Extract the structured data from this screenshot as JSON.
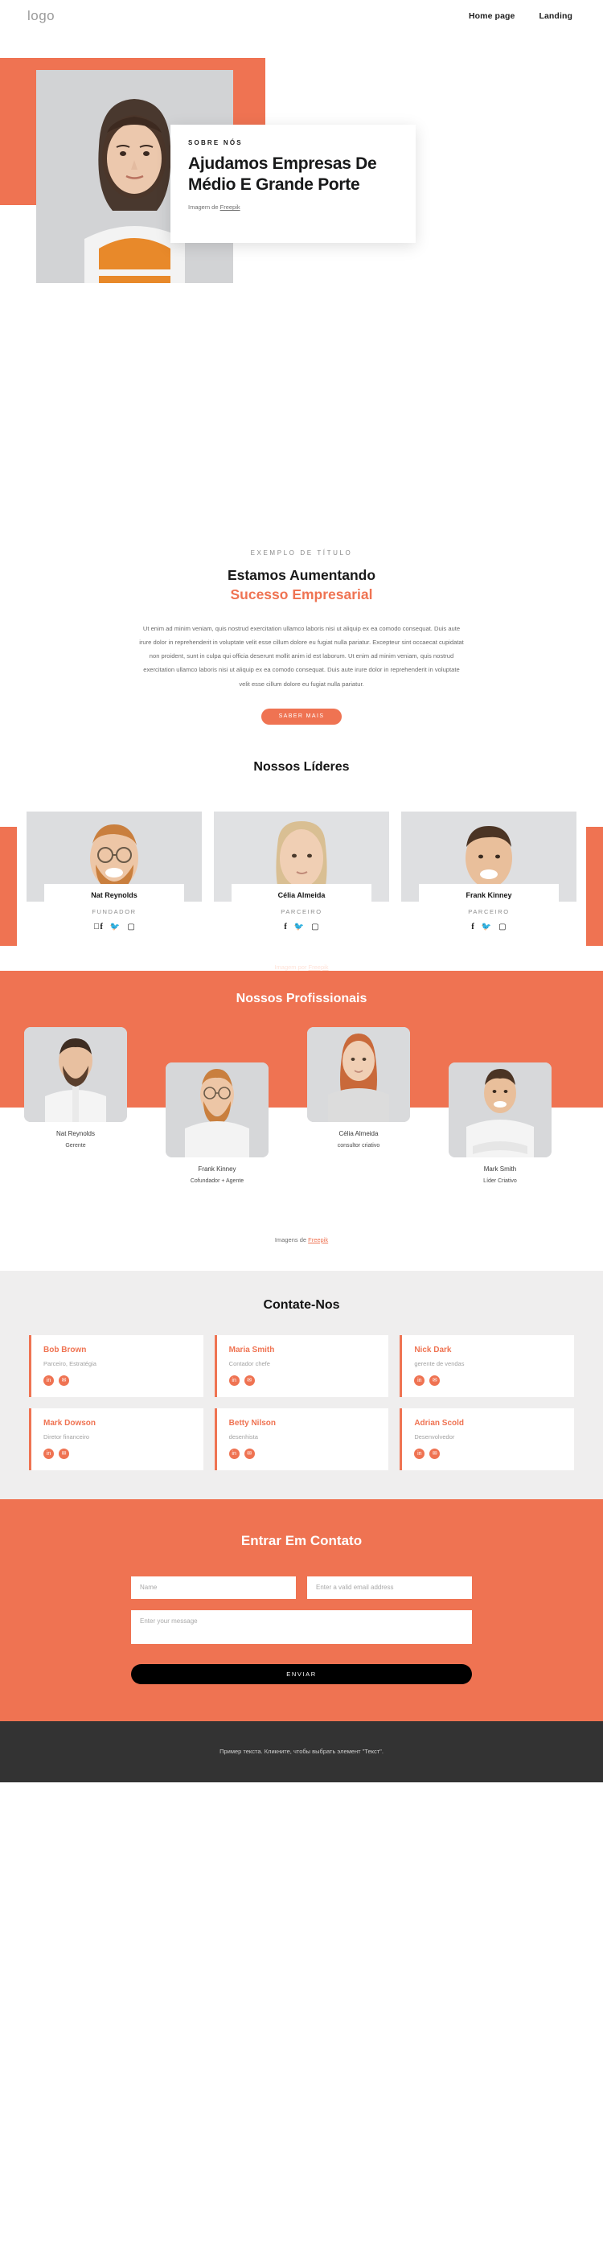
{
  "header": {
    "logo": "logo",
    "nav": [
      {
        "label": "Home page"
      },
      {
        "label": "Landing"
      }
    ]
  },
  "hero": {
    "eyebrow": "SOBRE NÓS",
    "title": "Ajudamos Empresas De Médio E Grande Porte",
    "credit_prefix": "Imagem de ",
    "credit_link": "Freepik",
    "accent_color": "#ef7352"
  },
  "intro": {
    "eyebrow": "EXEMPLO DE TÍTULO",
    "title_line1": "Estamos Aumentando",
    "title_line2": "Sucesso Empresarial",
    "paragraph": "Ut enim ad minim veniam, quis nostrud exercitation ullamco laboris nisi ut aliquip ex ea comodo consequat. Duis aute irure dolor in reprehenderit in voluptate velit esse cillum dolore eu fugiat nulla pariatur. Excepteur sint occaecat cupidatat non proident, sunt in culpa qui officia deserunt mollit anim id est laborum. Ut enim ad minim veniam, quis nostrud exercitation ullamco laboris nisi ut aliquip ex ea comodo consequat. Duis aute irure dolor in reprehenderit in voluptate velit esse cillum dolore eu fugiat nulla pariatur.",
    "button": "SABER MAIS"
  },
  "leaders": {
    "title": "Nossos Líderes",
    "credit_prefix": "Imagem por ",
    "credit_link": "Freepik",
    "social_icons": [
      "facebook-icon",
      "twitter-icon",
      "instagram-icon"
    ],
    "members": [
      {
        "name": "Nat Reynolds",
        "role": "FUNDADOR"
      },
      {
        "name": "Célia Almeida",
        "role": "PARCEIRO"
      },
      {
        "name": "Frank Kinney",
        "role": "PARCEIRO"
      }
    ]
  },
  "pros": {
    "title": "Nossos Profissionais",
    "credit_prefix": "Imagens de ",
    "credit_link": "Freepik",
    "members": [
      {
        "name": "Nat Reynolds",
        "role": "Gerente"
      },
      {
        "name": "Frank Kinney",
        "role": "Cofundador + Agente"
      },
      {
        "name": "Célia Almeida",
        "role": "consultor criativo"
      },
      {
        "name": "Mark Smith",
        "role": "Líder Criativo"
      }
    ]
  },
  "contact": {
    "title": "Contate-Nos",
    "icons": [
      "linkedin-icon",
      "mail-icon"
    ],
    "cards": [
      {
        "name": "Bob Brown",
        "role": "Parceiro, Estratégia"
      },
      {
        "name": "Maria Smith",
        "role": "Contador chefe"
      },
      {
        "name": "Nick Dark",
        "role": "gerente de vendas"
      },
      {
        "name": "Mark Dowson",
        "role": "Diretor financeiro"
      },
      {
        "name": "Betty Nilson",
        "role": "desenhista"
      },
      {
        "name": "Adrian Scold",
        "role": "Desenvolvedor"
      }
    ]
  },
  "form": {
    "title": "Entrar Em Contato",
    "name_placeholder": "Name",
    "email_placeholder": "Enter a valid email address",
    "message_placeholder": "Enter your message",
    "submit": "ENVIAR"
  },
  "footer": {
    "text": "Пример текста. Кликните, чтобы выбрать элемент \"Текст\"."
  }
}
